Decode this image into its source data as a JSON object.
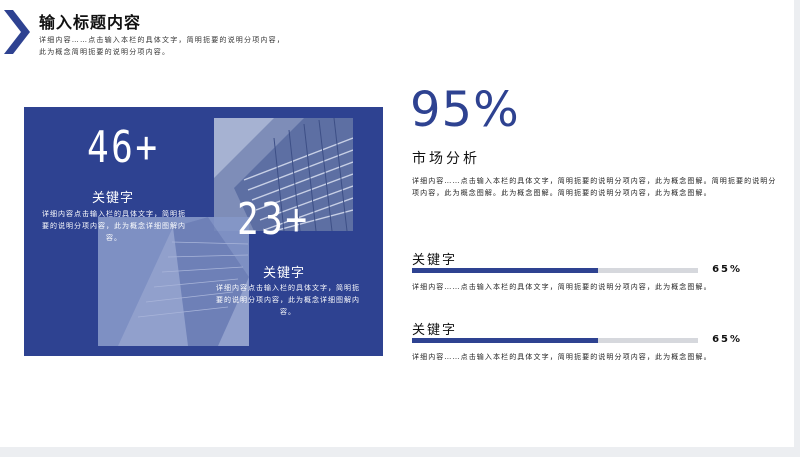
{
  "header": {
    "title": "输入标题内容",
    "desc": "详细内容……点击输入本栏的具体文字，简明扼要的说明分项内容，此为概念简明扼要的说明分项内容。",
    "accent": "#2e4291"
  },
  "panel": {
    "color": "#2e4291",
    "stat1": {
      "number": "46+",
      "keyword": "关键字",
      "desc": "详细内容点击输入栏的具体文字，简明扼要的说明分项内容，此为概念详细图解内容。"
    },
    "stat2": {
      "number": "23+",
      "keyword": "关键字",
      "desc": "详细内容点击输入栏的具体文字，简明扼要的说明分项内容，此为概念详细图解内容。"
    }
  },
  "summary": {
    "percent": "95%",
    "title": "市场分析",
    "desc": "详细内容……点击输入本栏的具体文字，简明扼要的说明分项内容，此为概念图解。简明扼要的说明分项内容，此为概念图解。此为概念图解。简明扼要的说明分项内容，此为概念图解。"
  },
  "bars": [
    {
      "label": "关键字",
      "percent_text": "65%",
      "value": 0.65,
      "desc": "详细内容……点击输入本栏的具体文字，简明扼要的说明分项内容，此为概念图解。"
    },
    {
      "label": "关键字",
      "percent_text": "65%",
      "value": 0.65,
      "desc": "详细内容……点击输入本栏的具体文字，简明扼要的说明分项内容，此为概念图解。"
    }
  ]
}
